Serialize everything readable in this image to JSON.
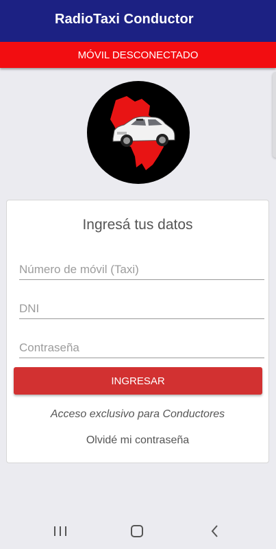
{
  "app": {
    "title": "RadioTaxi Conductor"
  },
  "banner": {
    "status_text": "MÓVIL DESCONECTADO",
    "color": "#f20d11"
  },
  "colors": {
    "appbar": "#1c2183",
    "button": "#d23131",
    "background": "#ebebf0"
  },
  "login": {
    "heading": "Ingresá tus datos",
    "mobile_number": {
      "placeholder": "Número de móvil (Taxi)",
      "value": ""
    },
    "dni": {
      "placeholder": "DNI",
      "value": ""
    },
    "password": {
      "placeholder": "Contraseña",
      "value": ""
    },
    "submit_label": "INGRESAR",
    "exclusive_note": "Acceso exclusivo para Conductores",
    "forgot_password": "Olvidé mi contraseña"
  },
  "system_nav": {
    "recents_icon": "recent-apps-icon",
    "home_icon": "home-icon",
    "back_icon": "back-icon"
  }
}
